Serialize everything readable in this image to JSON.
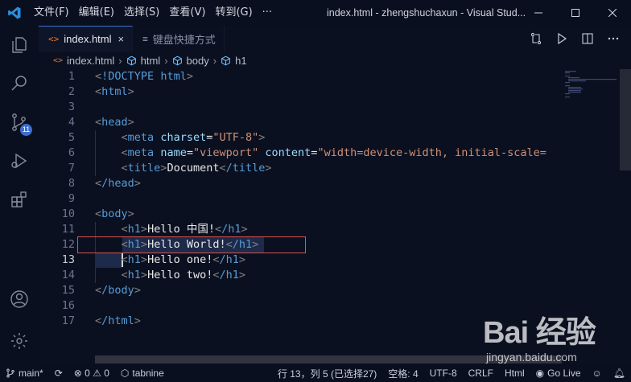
{
  "titlebar": {
    "menu": [
      "文件(F)",
      "编辑(E)",
      "选择(S)",
      "查看(V)",
      "转到(G)",
      "···"
    ],
    "window_title": "index.html - zhengshuchaxun - Visual Stud..."
  },
  "activity_bar": {
    "icons": [
      "explorer-icon",
      "search-icon",
      "source-control-icon",
      "run-debug-icon",
      "extensions-icon",
      "account-icon",
      "settings-gear-icon"
    ],
    "scm_badge": "11"
  },
  "tabs": [
    {
      "icon": "<>",
      "label": "index.html",
      "close": "×",
      "active": true
    },
    {
      "icon": "≡",
      "label": "键盘快捷方式",
      "active": false
    }
  ],
  "breadcrumb": {
    "file": "index.html",
    "parts": [
      "html",
      "body",
      "h1"
    ]
  },
  "editor": {
    "lines": [
      {
        "n": "1",
        "text": "<!DOCTYPE html>"
      },
      {
        "n": "2",
        "text": "<html>"
      },
      {
        "n": "3",
        "text": ""
      },
      {
        "n": "4",
        "text": "<head>"
      },
      {
        "n": "5",
        "text": "    <meta charset=\"UTF-8\">"
      },
      {
        "n": "6",
        "text": "    <meta name=\"viewport\" content=\"width=device-width, initial-scale="
      },
      {
        "n": "7",
        "text": "    <title>Document</title>"
      },
      {
        "n": "8",
        "text": "</head>"
      },
      {
        "n": "9",
        "text": ""
      },
      {
        "n": "10",
        "text": "<body>"
      },
      {
        "n": "11",
        "text": "    <h1>Hello 中国!</h1>"
      },
      {
        "n": "12",
        "text": "    <h1>Hello World!</h1>"
      },
      {
        "n": "13",
        "text": "    <h1>Hello one!</h1>"
      },
      {
        "n": "14",
        "text": "    <h1>Hello two!</h1>"
      },
      {
        "n": "15",
        "text": "</body>"
      },
      {
        "n": "16",
        "text": ""
      },
      {
        "n": "17",
        "text": "</html>"
      }
    ]
  },
  "statusbar": {
    "branch": "main*",
    "sync": "⟳",
    "problems": "⊗ 0 ⚠ 0",
    "tabnine": "tabnine",
    "cursor": "行 13，列 5 (已选择27)",
    "spaces": "空格: 4",
    "encoding": "UTF-8",
    "eol": "CRLF",
    "language": "Html",
    "golive": "Go Live"
  },
  "watermark": {
    "main": "Bai 经验",
    "sub": "jingyan.baidu.com"
  }
}
